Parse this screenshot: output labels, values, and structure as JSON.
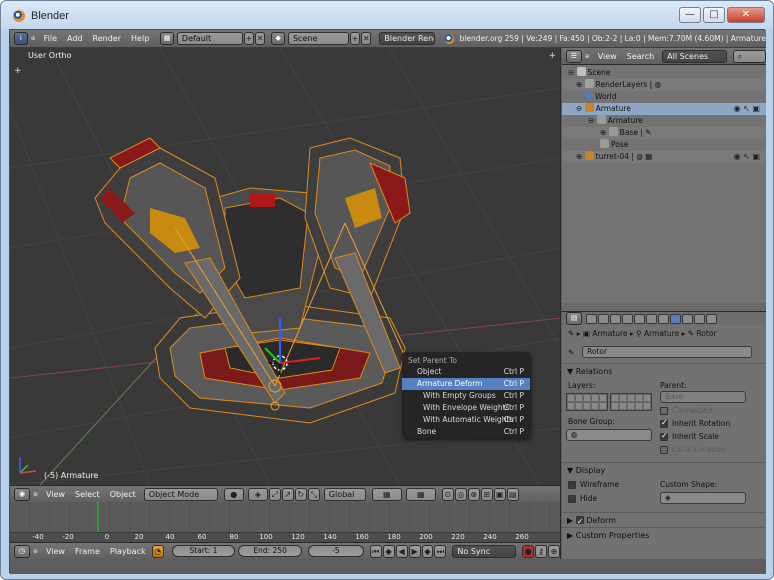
{
  "window": {
    "title": "Blender",
    "min": "—",
    "max": "□",
    "close": "✕"
  },
  "header": {
    "menus": [
      "File",
      "Add",
      "Render",
      "Help"
    ],
    "layout": "Default",
    "scene": "Scene",
    "engine": "Blender Render",
    "info": "blender.org 259 | Ve:249 | Fa:450 | Ob:2-2 | La:0 | Mem:7.70M (4.60M) | Armature"
  },
  "viewport": {
    "label": "User Ortho",
    "object": "(-5) Armature"
  },
  "context_menu": {
    "title": "Set Parent To",
    "items": [
      {
        "label": "Object",
        "shortcut": "Ctrl P"
      },
      {
        "label": "Armature Deform",
        "shortcut": "Ctrl P"
      },
      {
        "label": "With Empty Groups",
        "shortcut": "Ctrl P"
      },
      {
        "label": "With Envelope Weights",
        "shortcut": "Ctrl P"
      },
      {
        "label": "With Automatic Weights",
        "shortcut": "Ctrl P"
      },
      {
        "label": "Bone",
        "shortcut": "Ctrl P"
      }
    ]
  },
  "view3d_header": {
    "menus": [
      "View",
      "Select",
      "Object"
    ],
    "mode": "Object Mode",
    "orientation": "Global"
  },
  "timeline": {
    "ruler": [
      "-40",
      "-20",
      "0",
      "20",
      "40",
      "60",
      "80",
      "100",
      "120",
      "140",
      "160",
      "180",
      "200",
      "220",
      "240",
      "260"
    ],
    "menus": [
      "View",
      "Frame",
      "Playback"
    ],
    "start": "Start: 1",
    "end": "End: 250",
    "current": "-5",
    "sync": "No Sync"
  },
  "outliner": {
    "menus": [
      "View",
      "Search"
    ],
    "filter": "All Scenes",
    "rows": [
      {
        "label": "Scene"
      },
      {
        "label": "RenderLayers"
      },
      {
        "label": "World"
      },
      {
        "label": "Armature"
      },
      {
        "label": "Armature"
      },
      {
        "label": "Base"
      },
      {
        "label": "Pose"
      },
      {
        "label": "turret-04"
      }
    ]
  },
  "properties": {
    "breadcrumb": [
      "Armature",
      "Armature",
      "Rotor"
    ],
    "bone_name": "Rotor",
    "relations": {
      "title": "Relations",
      "layers_label": "Layers:",
      "parent_label": "Parent:",
      "parent_value": "Base",
      "connected": "Connected",
      "inherit_rotation": "Inherit Rotation",
      "inherit_scale": "Inherit Scale",
      "local_location": "Local Location",
      "bone_group_label": "Bone Group:"
    },
    "display": {
      "title": "Display",
      "wireframe": "Wireframe",
      "hide": "Hide",
      "custom_shape_label": "Custom Shape:"
    },
    "deform": "Deform",
    "custom_properties": "Custom Properties"
  }
}
